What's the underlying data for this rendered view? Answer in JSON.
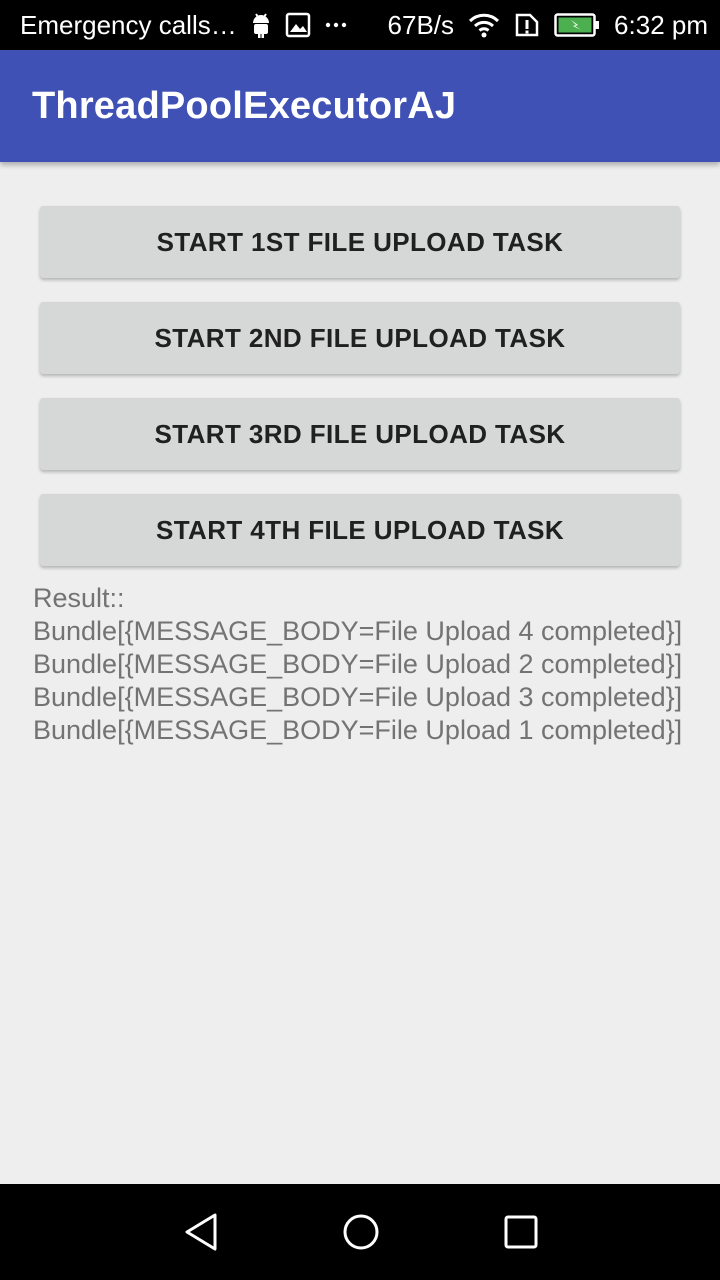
{
  "status_bar": {
    "carrier_text": "Emergency calls…",
    "network_speed": "67B/s",
    "time": "6:32 pm",
    "icons": [
      "android-debug-icon",
      "image-icon",
      "more-icon",
      "wifi-icon",
      "sim-alert-icon",
      "battery-charging-icon"
    ]
  },
  "app_bar": {
    "title": "ThreadPoolExecutorAJ",
    "color": "#3f51b5"
  },
  "buttons": [
    {
      "label": "START 1ST FILE UPLOAD TASK"
    },
    {
      "label": "START 2ND FILE UPLOAD TASK"
    },
    {
      "label": "START 3RD FILE UPLOAD TASK"
    },
    {
      "label": "START 4TH FILE UPLOAD TASK"
    }
  ],
  "result": {
    "header": "Result::",
    "lines": [
      "Bundle[{MESSAGE_BODY=File Upload 4 completed}]",
      "Bundle[{MESSAGE_BODY=File Upload 2 completed}]",
      "Bundle[{MESSAGE_BODY=File Upload 3 completed}]",
      "Bundle[{MESSAGE_BODY=File Upload 1 completed}]"
    ]
  },
  "nav_bar": {
    "icons": [
      "back-icon",
      "home-icon",
      "recents-icon"
    ]
  }
}
